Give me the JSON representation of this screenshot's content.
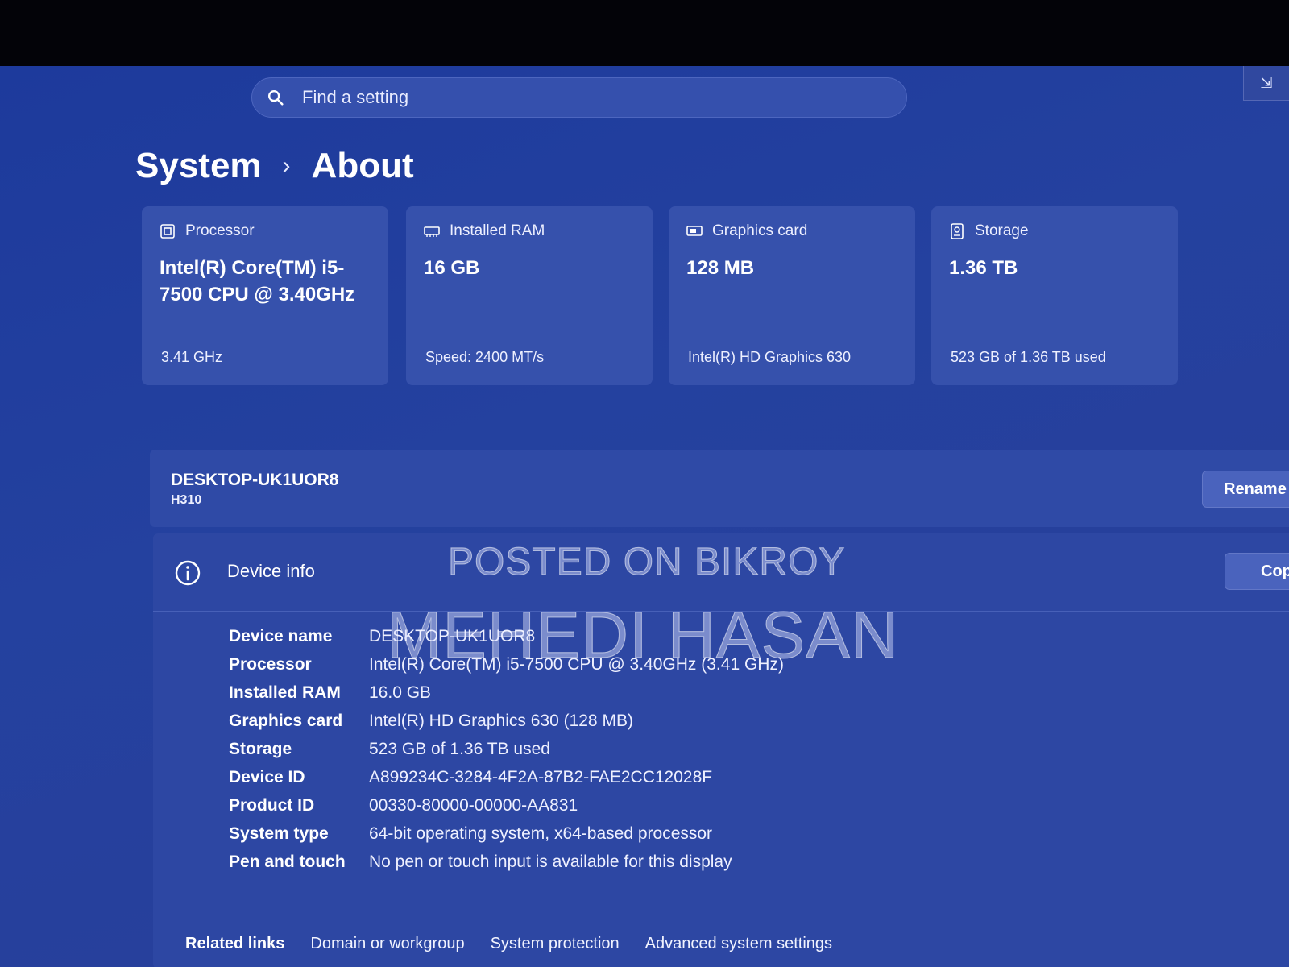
{
  "search": {
    "placeholder": "Find a setting"
  },
  "breadcrumb": {
    "parent": "System",
    "separator": "›",
    "current": "About"
  },
  "cards": [
    {
      "label": "Processor",
      "value": "Intel(R) Core(TM) i5-7500 CPU @ 3.40GHz",
      "sub": "3.41 GHz",
      "icon": "processor-icon"
    },
    {
      "label": "Installed RAM",
      "value": "16 GB",
      "sub": "Speed: 2400 MT/s",
      "icon": "ram-icon"
    },
    {
      "label": "Graphics card",
      "value": "128 MB",
      "sub": "Intel(R) HD Graphics 630",
      "icon": "graphics-card-icon"
    },
    {
      "label": "Storage",
      "value": "1.36 TB",
      "sub": "523 GB of 1.36 TB used",
      "icon": "storage-icon"
    }
  ],
  "pc": {
    "name": "DESKTOP-UK1UOR8",
    "model": "H310",
    "rename_label": "Rename"
  },
  "device_info": {
    "title": "Device info",
    "copy_label": "Copy",
    "rows": [
      {
        "key": "Device name",
        "value": "DESKTOP-UK1UOR8"
      },
      {
        "key": "Processor",
        "value": "Intel(R) Core(TM) i5-7500 CPU @ 3.40GHz (3.41 GHz)"
      },
      {
        "key": "Installed RAM",
        "value": "16.0 GB"
      },
      {
        "key": "Graphics card",
        "value": "Intel(R) HD Graphics 630 (128 MB)"
      },
      {
        "key": "Storage",
        "value": "523 GB of 1.36 TB used"
      },
      {
        "key": "Device ID",
        "value": "A899234C-3284-4F2A-87B2-FAE2CC12028F"
      },
      {
        "key": "Product ID",
        "value": "00330-80000-00000-AA831"
      },
      {
        "key": "System type",
        "value": "64-bit operating system, x64-based processor"
      },
      {
        "key": "Pen and touch",
        "value": "No pen or touch input is available for this display"
      }
    ]
  },
  "related": {
    "label": "Related links",
    "links": [
      "Domain or workgroup",
      "System protection",
      "Advanced system settings"
    ]
  },
  "watermark": {
    "line1": "POSTED ON BIKROY",
    "line2": "MEHEDI HASAN"
  },
  "colors": {
    "background": "#24419f",
    "card": "#3651ac",
    "panel": "#2d47a3",
    "text": "#ffffff"
  }
}
